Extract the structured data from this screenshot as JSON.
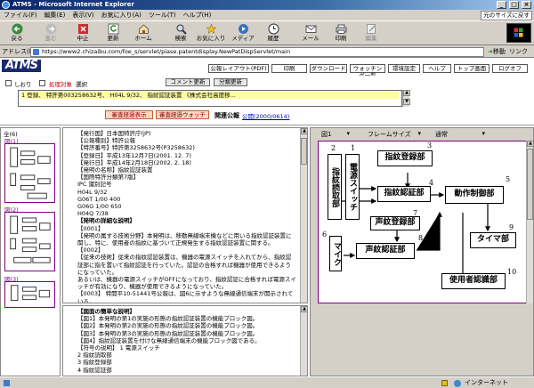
{
  "window": {
    "title": "ATMS - Microsoft Internet Explorer"
  },
  "menu": {
    "items": [
      "ファイル(F)",
      "編集(E)",
      "表示(V)",
      "お気に入り(A)",
      "ツール(T)",
      "ヘルプ(H)"
    ],
    "fit_size": "元のサイズに戻す"
  },
  "toolbar": {
    "back": "戻る",
    "forward": "進む",
    "stop": "中止",
    "refresh": "更新",
    "home": "ホーム",
    "search": "検索",
    "favorites": "お気に入り",
    "media": "メディア",
    "history": "履歴",
    "mail": "メール",
    "print": "印刷",
    "edit": "編集"
  },
  "address": {
    "label": "アドレス(D)",
    "url": "https://www2.chizaibu.com/foe_s/servlet/piase.patentdisplay.NewPatDispServlet/main",
    "go": "移動",
    "links": "リンク"
  },
  "app": {
    "logo": "ATMS",
    "nav": [
      "公報レイアウト(PDF)",
      "印刷",
      "ダウンロード",
      "ウォッチング一覧",
      "環境設定",
      "ヘルプ",
      "トップ画面",
      "ログオフ"
    ],
    "bookmark_label": "しおり",
    "status_prefix": "処理対象",
    "status_select": "選択",
    "comment_update": "コメント更新",
    "class_update": "分類更新",
    "list_row": "1  登録、 特許第003258632号、          H04L  9/32、        指紋認証装置 《株式会社高度移...",
    "exam_btn": "審査経過表示",
    "watch_btn": "審査経過ウォッチ",
    "pub_label": "関連公報",
    "pub_link": "公開(2000/0614)"
  },
  "thumbs": {
    "all": "全(6)",
    "page1": "図(1)",
    "page2": "図(2)",
    "page3": "図(3)"
  },
  "doc": {
    "lines": [
      "【発行国】日本国特許庁(JP)",
      "【公報種別】特許公報",
      "【特許番号】特許第3258632号(P3258632)",
      "【登録日】平成13年12月7日(2001. 12. 7)",
      "【発行日】平成14年2月18日(2002. 2. 18)",
      "【発明の名称】指紋認証装置",
      "【国際特許分類第7版】",
      "     IPC       識別記号",
      "     H04L 9/32",
      "     G06T 1/00 400",
      "     G06G 1/00 650",
      "     H04Q 7/38"
    ],
    "detail_head": "【発明の詳細な説明】",
    "p0001": "【0001】",
    "p0001_text": "【発明の属する技術分野】本発明は、移動無線端末機などに用いる指紋認証装置に関し、特に、使用者の指紋に基づいて正規発生する指紋認証装置に関する。",
    "p0002": "【0002】",
    "p0002_text": "【従来の技術】従来の指紋認証装置は、機器の電源スイッチを入れてから、指紋認証部に指を置いて指紋認証を行っていた。認証の合格すれば機器が使用できるようになっていた。",
    "p0003": "あるいは、機器の電源スイッチがOFFになっており、指紋認証に合格すれば電源スイッチが有効になり、機器が使用できるようになっていた。",
    "p0003b": "【0003】 特開平10-51441号公報は、図6に示すような無線通信端末が開示されている。"
  },
  "figure_desc": {
    "head": "【図面の簡単な説明】",
    "lines": [
      "【図1】本発明の第1の実施の形態の指紋認証装置の機能ブロック図。",
      "【図2】本発明の第2の実施の形態の指紋認証装置の機能ブロック図。",
      "【図3】本発明の第3の実施の形態の指紋認証装置の機能ブロック図。",
      "【図4】指紋認証装置を付けな無線通信端末の機能ブロック図である。",
      "【符号の説明】 1  電源スイッチ",
      "2  指紋読取部",
      "3  指紋登録部",
      "4  指紋認証部",
      "5  動作制御部",
      "6  マイク",
      "7  声紋登録部",
      "8  声紋認証部"
    ]
  },
  "viewer": {
    "fig_select": "図1",
    "frame_select": "フレームサイズ",
    "mode_select": "通常"
  },
  "diagram": {
    "fingerprint_reader": "指紋読取部",
    "power_switch": "電源スイッチ",
    "fp_register": "指紋登録部",
    "fp_auth": "指紋認証部",
    "op_control": "動作制御部",
    "voice_register": "声紋登録部",
    "mic": "マイク",
    "voice_auth": "声紋認証部",
    "timer": "タイマ部",
    "user_auth": "使用者認識部",
    "nums": [
      "1",
      "2",
      "3",
      "4",
      "5",
      "6",
      "7",
      "8",
      "9",
      "10"
    ]
  },
  "statusbar": {
    "text": "",
    "zone": "インターネット"
  }
}
